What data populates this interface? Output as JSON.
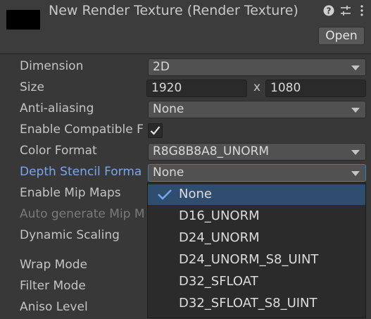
{
  "header": {
    "title": "New Render Texture (Render Texture)",
    "open_label": "Open",
    "icons": [
      "help-icon",
      "presets-icon",
      "kebab-menu-icon"
    ]
  },
  "fields": {
    "dimension": {
      "label": "Dimension",
      "value": "2D"
    },
    "size": {
      "label": "Size",
      "width": "1920",
      "separator": "x",
      "height": "1080"
    },
    "anti_aliasing": {
      "label": "Anti-aliasing",
      "value": "None"
    },
    "enable_compatible": {
      "label": "Enable Compatible F",
      "checked": true
    },
    "color_format": {
      "label": "Color Format",
      "value": "R8G8B8A8_UNORM"
    },
    "depth_stencil": {
      "label": "Depth Stencil Forma",
      "value": "None"
    },
    "enable_mip_maps": {
      "label": "Enable Mip Maps"
    },
    "auto_generate_mip": {
      "label": "Auto generate Mip M"
    },
    "dynamic_scaling": {
      "label": "Dynamic Scaling"
    },
    "wrap_mode": {
      "label": "Wrap Mode"
    },
    "filter_mode": {
      "label": "Filter Mode"
    },
    "aniso_level": {
      "label": "Aniso Level"
    }
  },
  "popup": {
    "selected": "None",
    "items": [
      "None",
      "D16_UNORM",
      "D24_UNORM",
      "D24_UNORM_S8_UINT",
      "D32_SFLOAT",
      "D32_SFLOAT_S8_UINT"
    ]
  },
  "colors": {
    "background": "#383838",
    "focused_label": "#7aa7ea",
    "popup_selected": "#2f4d6f"
  }
}
